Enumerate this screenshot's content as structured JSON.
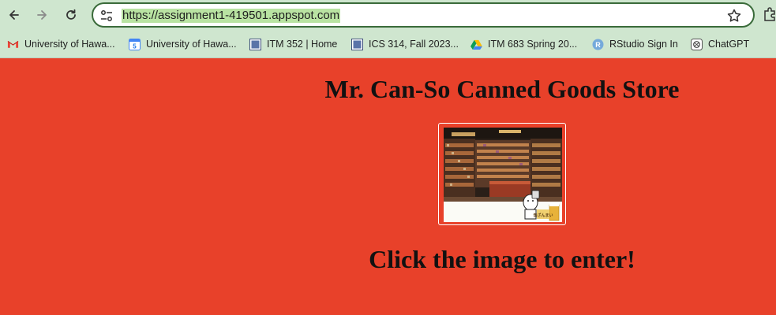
{
  "browser": {
    "url": "https://assignment1-419501.appspot.com",
    "bookmarks": [
      {
        "label": "University of Hawa...",
        "icon": "gmail-icon"
      },
      {
        "label": "University of Hawa...",
        "icon": "calendar-icon"
      },
      {
        "label": "ITM 352 | Home",
        "icon": "canvas-icon"
      },
      {
        "label": "ICS 314, Fall 2023...",
        "icon": "canvas-icon"
      },
      {
        "label": "ITM 683 Spring 20...",
        "icon": "drive-icon"
      },
      {
        "label": "RStudio Sign In",
        "icon": "rstudio-icon"
      },
      {
        "label": "ChatGPT",
        "icon": "chatgpt-icon"
      }
    ]
  },
  "page": {
    "background": "#e8412a",
    "title": "Mr. Can-So Canned Goods Store",
    "cta": "Click the image to enter!",
    "image_logo_text": "缶ざんまい"
  }
}
